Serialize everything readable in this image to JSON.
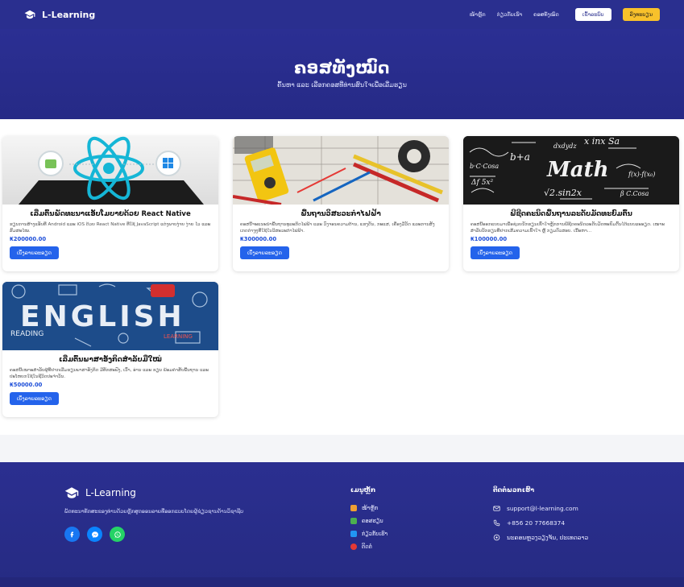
{
  "nav": {
    "brand": "L-Learning",
    "links": [
      "ໜ້າຫຼັກ",
      "ກ່ຽວກັບເຮົາ",
      "ຄອສທັງໝົດ"
    ],
    "login": "ເຂົ້າລະບົບ",
    "register": "ລົງທະບຽນ"
  },
  "hero": {
    "title": "ຄອສທັງໝົດ",
    "subtitle": "ຄົ້ນຫາ ແລະ ເລືອກຄອສທີ່ທ່ານສົນໃຈເພື່ອເລີ່ມຮຽນ"
  },
  "courses": [
    {
      "title": "ເລີ່ມຕົ້ນພັດທະນາແອັບໂມບາຍດ້ວຍ React Native",
      "desc": "ຮຽນການສ້າງແອັບທີ່ Android ແລະ iOS ດ້ວຍ React Native ທີ່ໃຊ້ JavaScript ແຕ່ງພາບງ່າຍ ງ່າຍ ໄວ ແລະ ສົມສະໄໝ.",
      "price": "₭200000.00",
      "button": "ເບິ່ງລາຍລະອຽດ"
    },
    {
      "title": "ພື້ນຖານວິສະວະກຳໄຟຟ້າ",
      "desc": "ຄອສນີ້ຈະແນະນຳພື້ນຖານທຸລະກິດໄຟຟ້າ ແລະ ວົງຈອນຄວາມຕ້ານ, ແຮງດັນ, ກະແສ, ເຄື່ອງມືວັດ ແລະການສັງເກດຕ່າງໆທີ່ໃຊ້ໃນວິສະວະກຳໄຟຟ້າ.",
      "price": "₭300000.00",
      "button": "ເບິ່ງລາຍລະອຽດ"
    },
    {
      "title": "ພີຊີດຄະນິດພື້ນຖານລະດັບມັດທະຍົມຕົ້ນ",
      "desc": "ຄອສນີ້ອອກແບບມາເພື່ອຊ່ວຍນັກຮຽນເຂົ້າໃຈຫຼັກການພີຊີດຄະນິດລະດັບມັດທະຍົມຕົ້ນໄດ້ແບບລະອຽດ. ເໝາະສຳລັບນັກຮຽນທີ່ຢາກເສີມຄວາມເຂົ້າໃຈ ຫຼື ກຽມຕົວສອບ. ເນື້ອຫາ...",
      "price": "₭100000.00",
      "button": "ເບິ່ງລາຍລະອຽດ"
    },
    {
      "title": "ເລີ່ມຕົ້ນພາສາອັງກິດສຳລັບມືໃໝ່",
      "desc": "ຄອສນີ້ເໝາະສຳລັບຜູ້ທີ່ຢາກເລີ່ມຮຽນພາສາອັງກິດ ມີທັກສະຟັງ, ເວົ້າ, ອ່ານ ແລະ ຂຽນ ພ້ອມຄຳສັບພື້ນຖານ ແລະ ປະໂຫຍກໃຊ້ໃນຊີວິດປະຈຳວັນ.",
      "price": "₭50000.00",
      "button": "ເບິ່ງລາຍລະອຽດ"
    }
  ],
  "footer": {
    "brand": "L-Learning",
    "tagline": "ພັດທະນາທັກສະຂອງທ່ານດ້ວຍຫຼັກສູດອອນລາຍທີ່ອອກແບບໂດຍຜູ້ຊ່ຽວຊານດ້ານວິຊາຊີບ",
    "menu_title": "ເມນູຫຼັກ",
    "menu": [
      "ໜ້າຫຼັກ",
      "ຄອສຮຽນ",
      "ກ່ຽວກັບເຮົາ",
      "ຕິດຕໍ່"
    ],
    "contact_title": "ຕິດຕໍ່ພວກເຮົາ",
    "email": "support@l-learning.com",
    "phone": "+856 20 77668374",
    "address": "ນະຄອນຫຼວງວຽງຈັນ, ປະເທດລາວ"
  },
  "colors": {
    "nav": "#2a2f8f",
    "accent_blue": "#2463eb",
    "accent_yellow": "#f8c12b",
    "price": "#1d4ed8"
  }
}
